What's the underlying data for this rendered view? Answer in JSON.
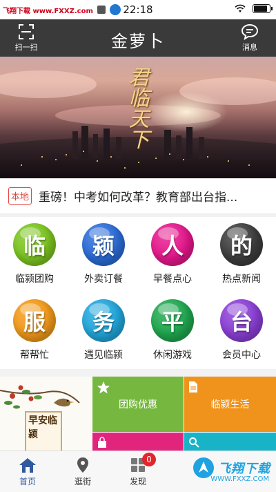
{
  "status_bar": {
    "watermark_left": "飞翔下载 www.FXXZ.com",
    "time": "22:18",
    "battery_level": 0.85
  },
  "header": {
    "title": "金萝卜",
    "scan_label": "扫一扫",
    "message_label": "消息"
  },
  "banner": {
    "calligraphy": "君临天下"
  },
  "news": {
    "tag": "本地",
    "headline": "重磅！中考如何改革？教育部出台指..."
  },
  "grid": {
    "items": [
      {
        "char": "临",
        "label": "临颍团购",
        "color": "#7cc520",
        "icon": "ball-icon"
      },
      {
        "char": "颍",
        "label": "外卖订餐",
        "color": "#2b6cd8",
        "icon": "ball-icon"
      },
      {
        "char": "人",
        "label": "早餐点心",
        "color": "#e5178c",
        "icon": "ball-icon"
      },
      {
        "char": "的",
        "label": "热点新闻",
        "color": "#3d3d3d",
        "icon": "ball-icon"
      },
      {
        "char": "服",
        "label": "帮帮忙",
        "color": "#f29a19",
        "icon": "ball-icon"
      },
      {
        "char": "务",
        "label": "遇见临颍",
        "color": "#21a7dc",
        "icon": "ball-icon"
      },
      {
        "char": "平",
        "label": "休闲游戏",
        "color": "#1fa84f",
        "icon": "ball-icon"
      },
      {
        "char": "台",
        "label": "会员中心",
        "color": "#8b3fd6",
        "icon": "ball-icon"
      }
    ]
  },
  "promo": {
    "board_text": "早安临颍",
    "tiles": [
      {
        "label": "团购优惠",
        "icon": "star-icon"
      },
      {
        "label": "临颍生活",
        "icon": "document-icon"
      },
      {
        "label": "",
        "icon": "bag-icon"
      },
      {
        "label": "",
        "icon": "search-icon"
      }
    ]
  },
  "tabbar": {
    "tabs": [
      {
        "label": "首页",
        "icon": "home-icon"
      },
      {
        "label": "逛街",
        "icon": "location-pin-icon"
      },
      {
        "label": "发现",
        "icon": "grid-icon",
        "badge": "0"
      }
    ]
  },
  "watermark": {
    "text": "飞翔下载",
    "url": "WWW.FXXZ.COM"
  },
  "colors": {
    "header_bg": "#3a3a3a",
    "accent_red": "#e2443c",
    "active_tab": "#2f5aa0"
  }
}
